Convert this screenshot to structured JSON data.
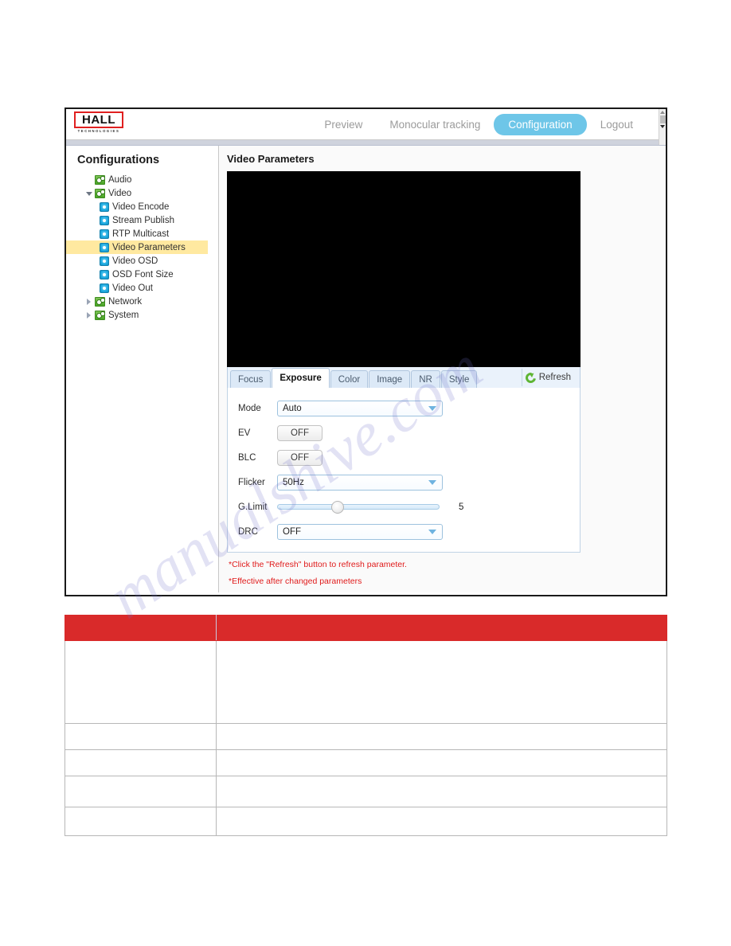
{
  "app": {
    "logo": {
      "word": "HALL",
      "sub": "TECHNOLOGIES"
    },
    "nav": [
      {
        "label": "Preview",
        "active": false
      },
      {
        "label": "Monocular tracking",
        "active": false
      },
      {
        "label": "Configuration",
        "active": true
      },
      {
        "label": "Logout",
        "active": false
      }
    ]
  },
  "sidebar": {
    "title": "Configurations",
    "items": [
      {
        "label": "Audio",
        "level": 1,
        "twisty": "none",
        "icon": "folder",
        "selected": false
      },
      {
        "label": "Video",
        "level": 1,
        "twisty": "expanded",
        "icon": "folder",
        "selected": false
      },
      {
        "label": "Video Encode",
        "level": 2,
        "twisty": "none",
        "icon": "leaf",
        "selected": false
      },
      {
        "label": "Stream Publish",
        "level": 2,
        "twisty": "none",
        "icon": "leaf",
        "selected": false
      },
      {
        "label": "RTP Multicast",
        "level": 2,
        "twisty": "none",
        "icon": "leaf",
        "selected": false
      },
      {
        "label": "Video Parameters",
        "level": 2,
        "twisty": "none",
        "icon": "leaf",
        "selected": true
      },
      {
        "label": "Video OSD",
        "level": 2,
        "twisty": "none",
        "icon": "leaf",
        "selected": false
      },
      {
        "label": "OSD Font Size",
        "level": 2,
        "twisty": "none",
        "icon": "leaf",
        "selected": false
      },
      {
        "label": "Video Out",
        "level": 2,
        "twisty": "none",
        "icon": "leaf",
        "selected": false
      },
      {
        "label": "Network",
        "level": 1,
        "twisty": "collapsed",
        "icon": "folder",
        "selected": false
      },
      {
        "label": "System",
        "level": 1,
        "twisty": "collapsed",
        "icon": "folder",
        "selected": false
      }
    ]
  },
  "content": {
    "title": "Video Parameters",
    "tabs": [
      {
        "label": "Focus",
        "active": false
      },
      {
        "label": "Exposure",
        "active": true
      },
      {
        "label": "Color",
        "active": false
      },
      {
        "label": "Image",
        "active": false
      },
      {
        "label": "NR",
        "active": false
      },
      {
        "label": "Style",
        "active": false
      }
    ],
    "refresh_label": "Refresh",
    "form": {
      "mode": {
        "label": "Mode",
        "value": "Auto"
      },
      "ev": {
        "label": "EV",
        "value": "OFF"
      },
      "blc": {
        "label": "BLC",
        "value": "OFF"
      },
      "flicker": {
        "label": "Flicker",
        "value": "50Hz"
      },
      "glimit": {
        "label": "G.Limit",
        "value": "5",
        "percent": 33
      },
      "drc": {
        "label": "DRC",
        "value": "OFF"
      }
    },
    "notes": [
      "*Click the \"Refresh\" button to refresh parameter.",
      "*Effective after changed parameters"
    ]
  },
  "watermark": {
    "text": "manualshive.com"
  },
  "colors": {
    "accent_blue": "#6ec6e8",
    "highlight_yellow": "#ffe9a0",
    "note_red": "#e01b1b",
    "table_header_red": "#d92a2a",
    "logo_red": "#e02020",
    "refresh_green": "#5fb534"
  }
}
